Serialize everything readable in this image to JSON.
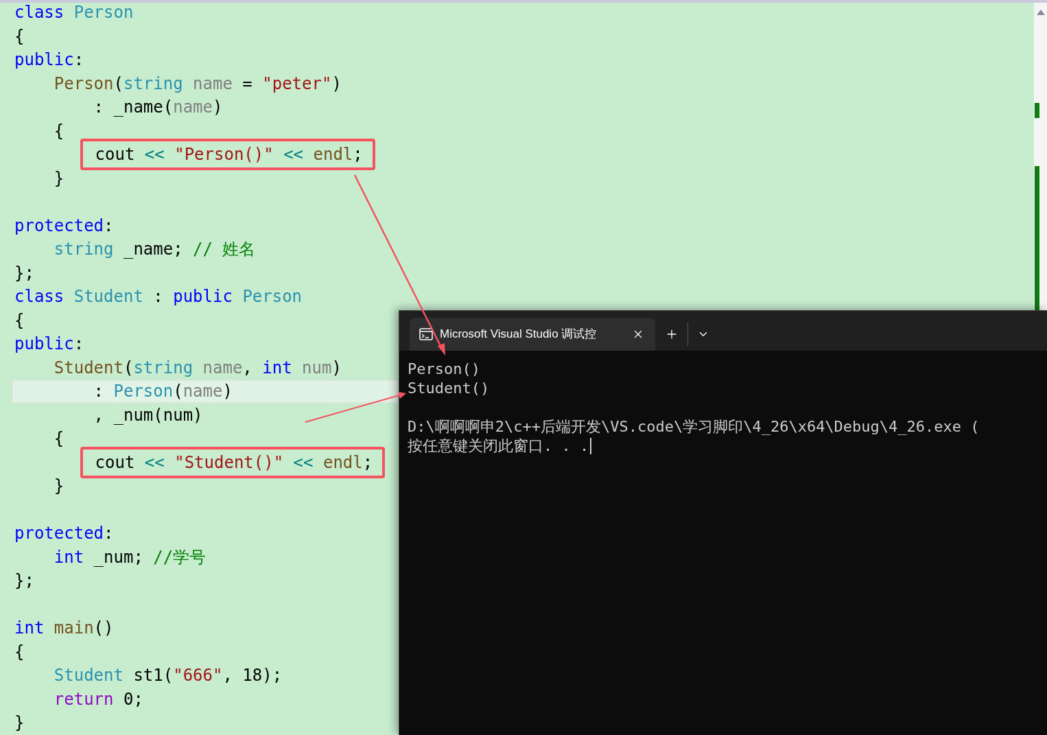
{
  "editor": {
    "lines": [
      {
        "boxed": false,
        "current": false,
        "tokens": [
          {
            "kind": "kw",
            "text": "class "
          },
          {
            "kind": "type",
            "text": "Person"
          }
        ]
      },
      {
        "boxed": false,
        "current": false,
        "tokens": [
          {
            "kind": "plain",
            "text": "{"
          }
        ]
      },
      {
        "boxed": false,
        "current": false,
        "tokens": [
          {
            "kind": "kw",
            "text": "public"
          },
          {
            "kind": "plain",
            "text": ":"
          }
        ]
      },
      {
        "boxed": false,
        "current": false,
        "tokens": [
          {
            "kind": "fn",
            "text": "    Person"
          },
          {
            "kind": "plain",
            "text": "("
          },
          {
            "kind": "type",
            "text": "string "
          },
          {
            "kind": "param",
            "text": "name"
          },
          {
            "kind": "plain",
            "text": " = "
          },
          {
            "kind": "str",
            "text": "\"peter\""
          },
          {
            "kind": "plain",
            "text": ")"
          }
        ]
      },
      {
        "boxed": false,
        "current": false,
        "tokens": [
          {
            "kind": "plain",
            "text": "        : _name("
          },
          {
            "kind": "param",
            "text": "name"
          },
          {
            "kind": "plain",
            "text": ")"
          }
        ]
      },
      {
        "boxed": false,
        "current": false,
        "tokens": [
          {
            "kind": "plain",
            "text": "    {"
          }
        ]
      },
      {
        "boxed": true,
        "current": false,
        "tokens": [
          {
            "kind": "plain",
            "text": "        cout "
          },
          {
            "kind": "op",
            "text": "<< "
          },
          {
            "kind": "str",
            "text": "\"Person()\" "
          },
          {
            "kind": "op",
            "text": "<< "
          },
          {
            "kind": "fn",
            "text": "endl"
          },
          {
            "kind": "plain",
            "text": ";"
          }
        ]
      },
      {
        "boxed": false,
        "current": false,
        "tokens": [
          {
            "kind": "plain",
            "text": "    }"
          }
        ]
      },
      {
        "boxed": false,
        "current": false
      },
      {
        "boxed": false,
        "current": false,
        "tokens": [
          {
            "kind": "kw",
            "text": "protected"
          },
          {
            "kind": "plain",
            "text": ":"
          }
        ]
      },
      {
        "boxed": false,
        "current": false,
        "tokens": [
          {
            "kind": "type",
            "text": "    string"
          },
          {
            "kind": "plain",
            "text": " _name; "
          },
          {
            "kind": "cmt",
            "text": "// 姓名"
          }
        ]
      },
      {
        "boxed": false,
        "current": false,
        "tokens": [
          {
            "kind": "plain",
            "text": "};"
          }
        ]
      },
      {
        "boxed": false,
        "current": false,
        "tokens": [
          {
            "kind": "kw",
            "text": "class "
          },
          {
            "kind": "type",
            "text": "Student"
          },
          {
            "kind": "plain",
            "text": " : "
          },
          {
            "kind": "kw",
            "text": "public "
          },
          {
            "kind": "type",
            "text": "Person"
          }
        ]
      },
      {
        "boxed": false,
        "current": false,
        "tokens": [
          {
            "kind": "plain",
            "text": "{"
          }
        ]
      },
      {
        "boxed": false,
        "current": false,
        "tokens": [
          {
            "kind": "kw",
            "text": "public"
          },
          {
            "kind": "plain",
            "text": ":"
          }
        ]
      },
      {
        "boxed": false,
        "current": false,
        "tokens": [
          {
            "kind": "fn",
            "text": "    Student"
          },
          {
            "kind": "plain",
            "text": "("
          },
          {
            "kind": "type",
            "text": "string "
          },
          {
            "kind": "param",
            "text": "name"
          },
          {
            "kind": "plain",
            "text": ", "
          },
          {
            "kind": "kw",
            "text": "int "
          },
          {
            "kind": "param",
            "text": "num"
          },
          {
            "kind": "plain",
            "text": ")"
          }
        ]
      },
      {
        "boxed": false,
        "current": true,
        "tokens": [
          {
            "kind": "plain",
            "text": "        : "
          },
          {
            "kind": "type",
            "text": "Person"
          },
          {
            "kind": "plain",
            "text": "("
          },
          {
            "kind": "param",
            "text": "name"
          },
          {
            "kind": "plain",
            "text": ")"
          }
        ]
      },
      {
        "boxed": false,
        "current": false,
        "tokens": [
          {
            "kind": "plain",
            "text": "        , _num(num)"
          }
        ]
      },
      {
        "boxed": false,
        "current": false,
        "tokens": [
          {
            "kind": "plain",
            "text": "    {"
          }
        ]
      },
      {
        "boxed": true,
        "current": false,
        "tokens": [
          {
            "kind": "plain",
            "text": "        cout "
          },
          {
            "kind": "op",
            "text": "<< "
          },
          {
            "kind": "str",
            "text": "\"Student()\" "
          },
          {
            "kind": "op",
            "text": "<< "
          },
          {
            "kind": "fn",
            "text": "endl"
          },
          {
            "kind": "plain",
            "text": ";"
          }
        ]
      },
      {
        "boxed": false,
        "current": false,
        "tokens": [
          {
            "kind": "plain",
            "text": "    }"
          }
        ]
      },
      {
        "boxed": false,
        "current": false
      },
      {
        "boxed": false,
        "current": false,
        "tokens": [
          {
            "kind": "kw",
            "text": "protected"
          },
          {
            "kind": "plain",
            "text": ":"
          }
        ]
      },
      {
        "boxed": false,
        "current": false,
        "tokens": [
          {
            "kind": "kw",
            "text": "    int"
          },
          {
            "kind": "plain",
            "text": " _num; "
          },
          {
            "kind": "cmt",
            "text": "//学号"
          }
        ]
      },
      {
        "boxed": false,
        "current": false,
        "tokens": [
          {
            "kind": "plain",
            "text": "};"
          }
        ]
      },
      {
        "boxed": false,
        "current": false
      },
      {
        "boxed": false,
        "current": false,
        "tokens": [
          {
            "kind": "kw",
            "text": "int "
          },
          {
            "kind": "fn",
            "text": "main"
          },
          {
            "kind": "plain",
            "text": "()"
          }
        ]
      },
      {
        "boxed": false,
        "current": false,
        "tokens": [
          {
            "kind": "plain",
            "text": "{"
          }
        ]
      },
      {
        "boxed": false,
        "current": false,
        "tokens": [
          {
            "kind": "type",
            "text": "    Student"
          },
          {
            "kind": "plain",
            "text": " st1("
          },
          {
            "kind": "str",
            "text": "\"666\""
          },
          {
            "kind": "plain",
            "text": ", 18);"
          }
        ]
      },
      {
        "boxed": false,
        "current": false,
        "tokens": [
          {
            "kind": "ret",
            "text": "    return"
          },
          {
            "kind": "plain",
            "text": " 0;"
          }
        ]
      },
      {
        "boxed": false,
        "current": false,
        "tokens": [
          {
            "kind": "plain",
            "text": "}"
          }
        ]
      }
    ]
  },
  "terminal": {
    "tab": {
      "title": "Microsoft Visual Studio 调试控",
      "selected": true
    },
    "output": [
      [
        "Person()",
        "Student()"
      ],
      [
        "D:\\啊啊啊申2\\c++后端开发\\VS.code\\学习脚印\\4_26\\x64\\Debug\\4_26.exe (",
        "按任意键关闭此窗口. . ."
      ]
    ]
  }
}
